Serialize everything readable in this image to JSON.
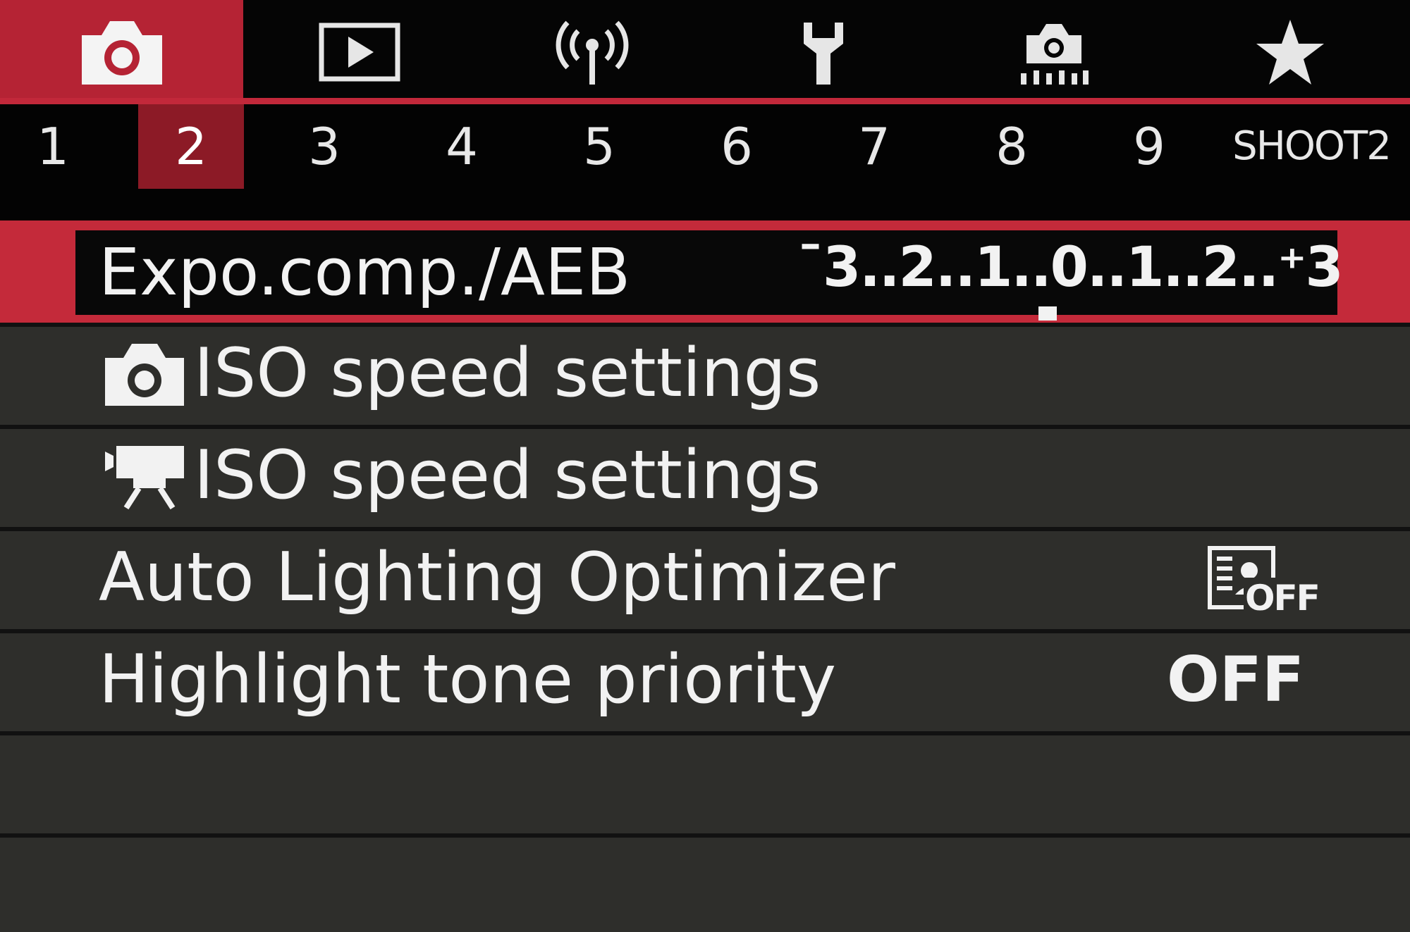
{
  "category_tabs": [
    {
      "name": "shooting",
      "icon": "camera-icon",
      "active": true
    },
    {
      "name": "playback",
      "icon": "playback-icon",
      "active": false
    },
    {
      "name": "wireless",
      "icon": "wireless-icon",
      "active": false
    },
    {
      "name": "setup",
      "icon": "wrench-icon",
      "active": false
    },
    {
      "name": "custom-functions",
      "icon": "camera-custom-icon",
      "active": false
    },
    {
      "name": "my-menu",
      "icon": "star-icon",
      "active": false
    }
  ],
  "page_tabs": [
    "1",
    "2",
    "3",
    "4",
    "5",
    "6",
    "7",
    "8",
    "9"
  ],
  "active_page": "2",
  "page_name": "SHOOT2",
  "menu": {
    "exposure": {
      "label": "Expo.comp./AEB",
      "scale_text": "¯3..2..1..0..1..2..⁺3",
      "value": 0
    },
    "iso_photo": {
      "label": "ISO speed settings",
      "icon": "camera-icon"
    },
    "iso_movie": {
      "label": "ISO speed settings",
      "icon": "movie-camera-icon"
    },
    "alo": {
      "label": "Auto Lighting Optimizer",
      "value_icon": "alo-off-icon",
      "value_text": "OFF"
    },
    "htp": {
      "label": "Highlight tone priority",
      "value": "OFF"
    }
  },
  "colors": {
    "accent_red": "#c42a3a",
    "active_tab_red": "#b52334",
    "active_page_red": "#8c1a26",
    "row_gray": "#2e2e2b",
    "text": "#f2f2f2"
  }
}
